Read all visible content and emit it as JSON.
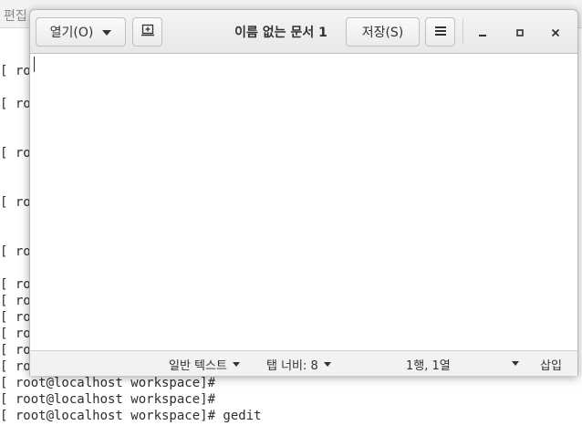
{
  "terminal": {
    "menu_edit_label": "편집",
    "lines": [
      "[ roo",
      "[ roo",
      "[ roo",
      "[ roo",
      "[ roo",
      "[ roo",
      "[ roo",
      "[ roo",
      "[ roo",
      "[ roo",
      "[ roo",
      "[ root@localhost workspace]#",
      "[ root@localhost workspace]#",
      "[ root@localhost workspace]# gedit"
    ]
  },
  "gedit": {
    "open_label": "열기(O)",
    "title": "이름 없는 문서 1",
    "save_label": "저장(S)",
    "statusbar": {
      "syntax": "일반 텍스트",
      "tab_width": "탭 너비: 8",
      "position": "1행, 1열",
      "mode": "삽입"
    }
  }
}
